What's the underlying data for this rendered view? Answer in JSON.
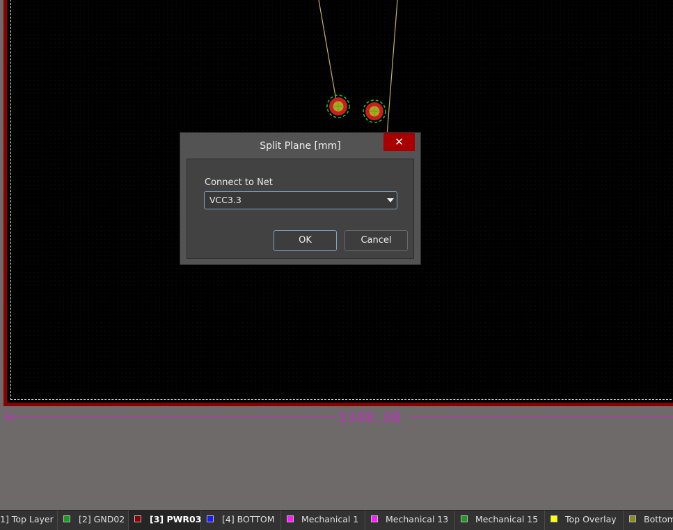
{
  "dialog": {
    "title": "Split Plane [mm]",
    "close_symbol": "✕",
    "net_label": "Connect to Net",
    "net_value": "VCC3.3",
    "ok_label": "OK",
    "cancel_label": "Cancel"
  },
  "dimension": {
    "value_text": "1348.00"
  },
  "layers": [
    {
      "label": "1] Top Layer",
      "color": null,
      "active": false
    },
    {
      "label": "[2] GND02",
      "color": "#1f9a1f",
      "active": false
    },
    {
      "label": "[3] PWR03",
      "color": "#8b0000",
      "active": true
    },
    {
      "label": "[4] BOTTOM",
      "color": "#1b1bff",
      "active": false
    },
    {
      "label": "Mechanical 1",
      "color": "#ff1bff",
      "active": false
    },
    {
      "label": "Mechanical 13",
      "color": "#ff1bff",
      "active": false
    },
    {
      "label": "Mechanical 15",
      "color": "#1f9a1f",
      "active": false
    },
    {
      "label": "Top Overlay",
      "color": "#ffff00",
      "active": false
    },
    {
      "label": "Bottom Overlay",
      "color": "#8a8a1e",
      "active": false
    }
  ],
  "colors": {
    "plane_border": "#8b0000",
    "dimension": "#c22fc2",
    "pad_outer": "#c81e1e",
    "pad_inner": "#b8a020",
    "pad_clearance": "#20c020",
    "track": "#c8b070",
    "close_button": "#a80000"
  }
}
